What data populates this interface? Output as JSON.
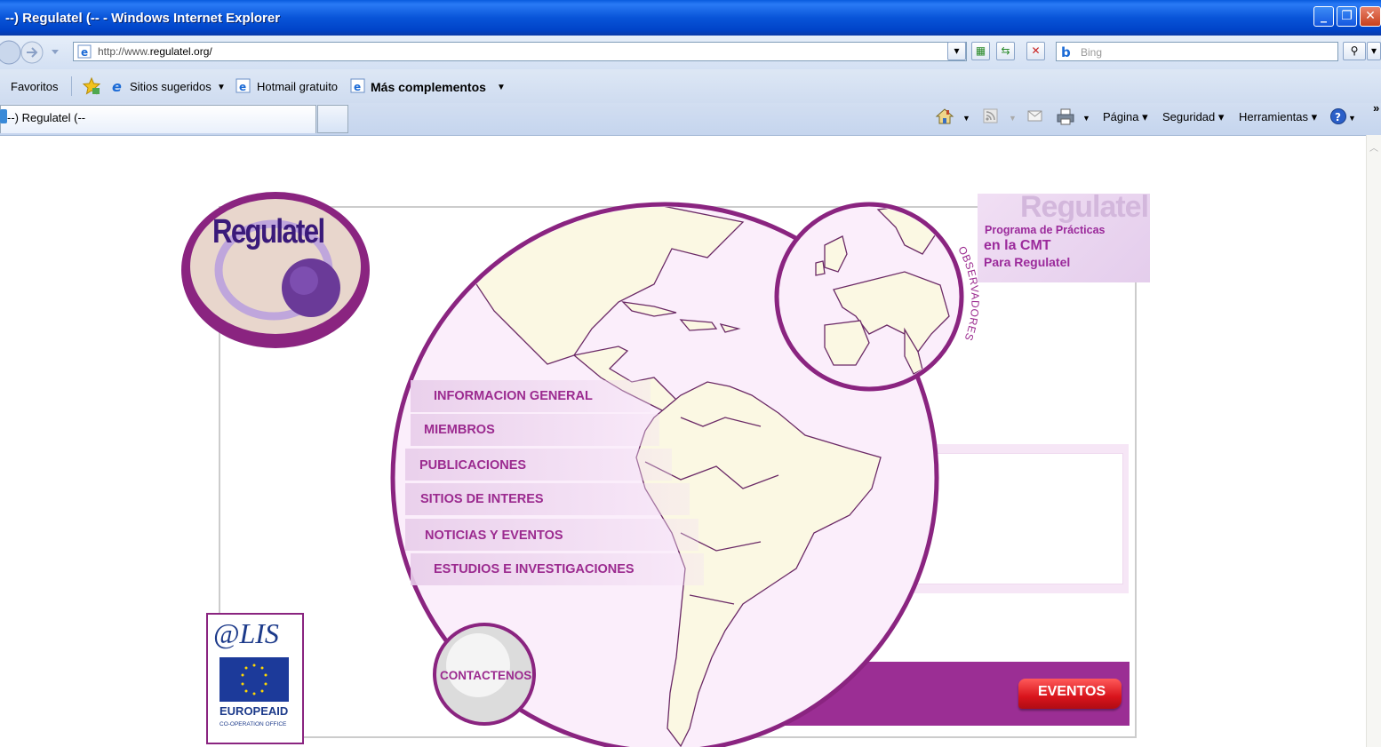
{
  "window": {
    "title": "--) Regulatel (-- - Windows Internet Explorer"
  },
  "address_bar": {
    "url_prefix": "http://www.",
    "url_domain": "regulatel.org/"
  },
  "search": {
    "placeholder": "Bing"
  },
  "favorites_bar": {
    "label": "Favoritos",
    "items": [
      "Sitios sugeridos",
      "Hotmail gratuito",
      "Más complementos"
    ]
  },
  "tabs": [
    {
      "label": "--) Regulatel (--"
    }
  ],
  "command_bar": {
    "page": "Página",
    "safety": "Seguridad",
    "tools": "Herramientas",
    "overflow": "»"
  },
  "site": {
    "logo_text": "Regulatel",
    "banner": {
      "watermark": "Regulatel",
      "line1": "Programa de Prácticas",
      "line2": "en la CMT",
      "line3": "Para Regulatel"
    },
    "observadores": "OBSERVADORES",
    "menu": [
      "INFORMACION GENERAL",
      "MIEMBROS",
      "PUBLICACIONES",
      "SITIOS DE INTERES",
      "NOTICIAS Y EVENTOS",
      "ESTUDIOS E INVESTIGACIONES"
    ],
    "contact": "CONTACTENOS",
    "events": "EVENTOS",
    "partner": {
      "alis": "@LIS",
      "europeaid": "EUROPEAID",
      "office": "CO-OPERATION OFFICE"
    }
  },
  "colors": {
    "brand_purple": "#9b2a8f",
    "title_blue": "#0a5cdd",
    "events_red": "#d8141c"
  }
}
